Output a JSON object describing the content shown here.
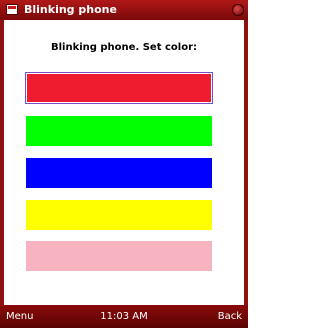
{
  "window": {
    "title": "Blinking phone",
    "app_icon": "app-window-icon",
    "close_icon": "close-icon"
  },
  "main": {
    "heading": "Blinking phone. Set color:",
    "colors": [
      {
        "color": "#ee1c2e",
        "selected": true
      },
      {
        "color": "#00ff00",
        "selected": false
      },
      {
        "color": "#0000ff",
        "selected": false
      },
      {
        "color": "#ffff00",
        "selected": false
      },
      {
        "color": "#f7b3c0",
        "selected": false
      }
    ]
  },
  "softkeys": {
    "left": "Menu",
    "center": "11:03 AM",
    "right": "Back"
  }
}
